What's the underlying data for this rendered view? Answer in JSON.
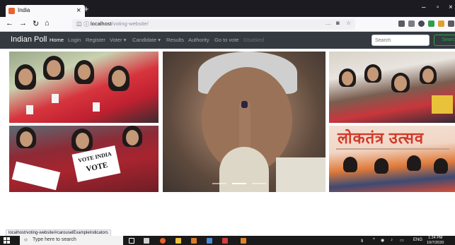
{
  "browser": {
    "tab_title": "India",
    "url_host": "localhost",
    "url_path": "/voting-website/",
    "url_actions_icon": "…"
  },
  "navbar": {
    "brand": "Indian Poll",
    "links": [
      {
        "label": "Home",
        "state": "active"
      },
      {
        "label": "Login",
        "state": "normal"
      },
      {
        "label": "Register",
        "state": "normal"
      },
      {
        "label": "Voter ▾",
        "state": "normal"
      },
      {
        "label": "Candidate ▾",
        "state": "normal"
      },
      {
        "label": "Results",
        "state": "normal"
      },
      {
        "label": "Authority",
        "state": "normal"
      },
      {
        "label": "Go to vote",
        "state": "normal"
      },
      {
        "label": "Disabled",
        "state": "disabled"
      }
    ],
    "search_placeholder": "Search",
    "search_button": "Search"
  },
  "photos": {
    "sign_line1": "VOTE INDIA",
    "sign_line2": "VOTE",
    "banner_text": "लोकतंत्र उत्सव",
    "carousel_active_index": 1
  },
  "status_link": "localhost/voting-website/#carouselExampleIndicators",
  "taskbar": {
    "search_placeholder": "Type here to search",
    "tray_lang": "ENG",
    "time": "1:24 PM",
    "date": "10/7/2020"
  },
  "colors": {
    "navbar_bg": "#343a40",
    "search_btn": "#28a745",
    "browser_chrome": "#1c1b22"
  }
}
